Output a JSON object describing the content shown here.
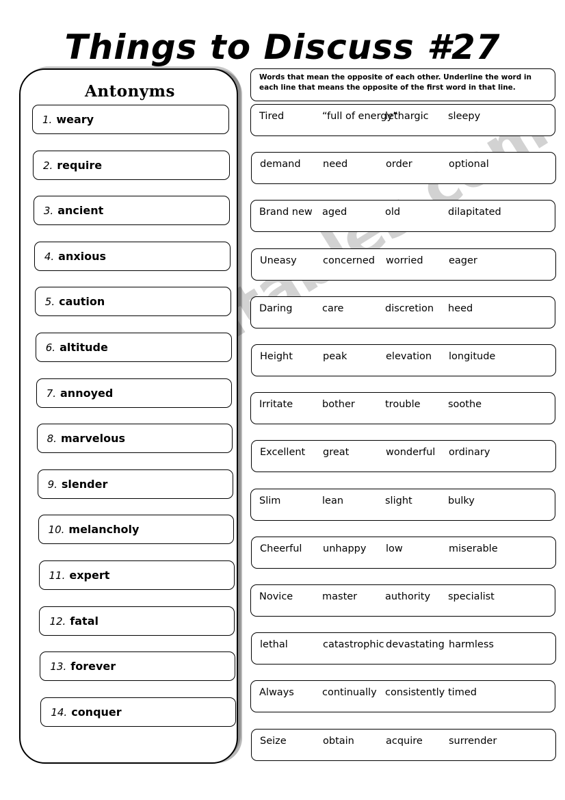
{
  "title": "Things to Discuss #27",
  "left_panel": {
    "heading": "Antonyms",
    "items": [
      {
        "num": "1.",
        "word": "weary"
      },
      {
        "num": "2.",
        "word": "require"
      },
      {
        "num": "3.",
        "word": "ancient"
      },
      {
        "num": "4.",
        "word": "anxious"
      },
      {
        "num": "5.",
        "word": "caution"
      },
      {
        "num": "6.",
        "word": "altitude"
      },
      {
        "num": "7.",
        "word": "annoyed"
      },
      {
        "num": "8.",
        "word": "marvelous"
      },
      {
        "num": "9.",
        "word": "slender"
      },
      {
        "num": "10.",
        "word": "melancholy"
      },
      {
        "num": "11.",
        "word": "expert"
      },
      {
        "num": "12.",
        "word": "fatal"
      },
      {
        "num": "13.",
        "word": "forever"
      },
      {
        "num": "14.",
        "word": "conquer"
      }
    ]
  },
  "instructions": "Words that mean the opposite of each other.   Underline the word in each line that means the opposite of the first word in that line.",
  "right_rows": [
    {
      "words": [
        "Tired",
        "“full of energy”",
        "lethargic",
        "sleepy"
      ]
    },
    {
      "words": [
        "demand",
        "need",
        "order",
        "optional"
      ]
    },
    {
      "words": [
        "Brand new",
        "aged",
        "old",
        "dilapitated"
      ]
    },
    {
      "words": [
        "Uneasy",
        "concerned",
        "worried",
        "eager"
      ]
    },
    {
      "words": [
        "Daring",
        "care",
        "discretion",
        "heed"
      ]
    },
    {
      "words": [
        "Height",
        "peak",
        "elevation",
        "longitude"
      ]
    },
    {
      "words": [
        "Irritate",
        "bother",
        "trouble",
        "soothe"
      ]
    },
    {
      "words": [
        "Excellent",
        "great",
        "wonderful",
        "ordinary"
      ]
    },
    {
      "words": [
        "Slim",
        "lean",
        "slight",
        "bulky"
      ]
    },
    {
      "words": [
        "Cheerful",
        "unhappy",
        "low",
        "miserable"
      ]
    },
    {
      "words": [
        "Novice",
        "master",
        "authority",
        "specialist"
      ]
    },
    {
      "words": [
        "lethal",
        "catastrophic",
        "devastating",
        "harmless"
      ]
    },
    {
      "words": [
        "Always",
        "continually",
        "consistently",
        "timed"
      ]
    },
    {
      "words": [
        "Seize",
        "obtain",
        "acquire",
        "surrender"
      ]
    }
  ],
  "watermark": {
    "text": "ESLprintables.com",
    "color": "#d2d2d2"
  }
}
